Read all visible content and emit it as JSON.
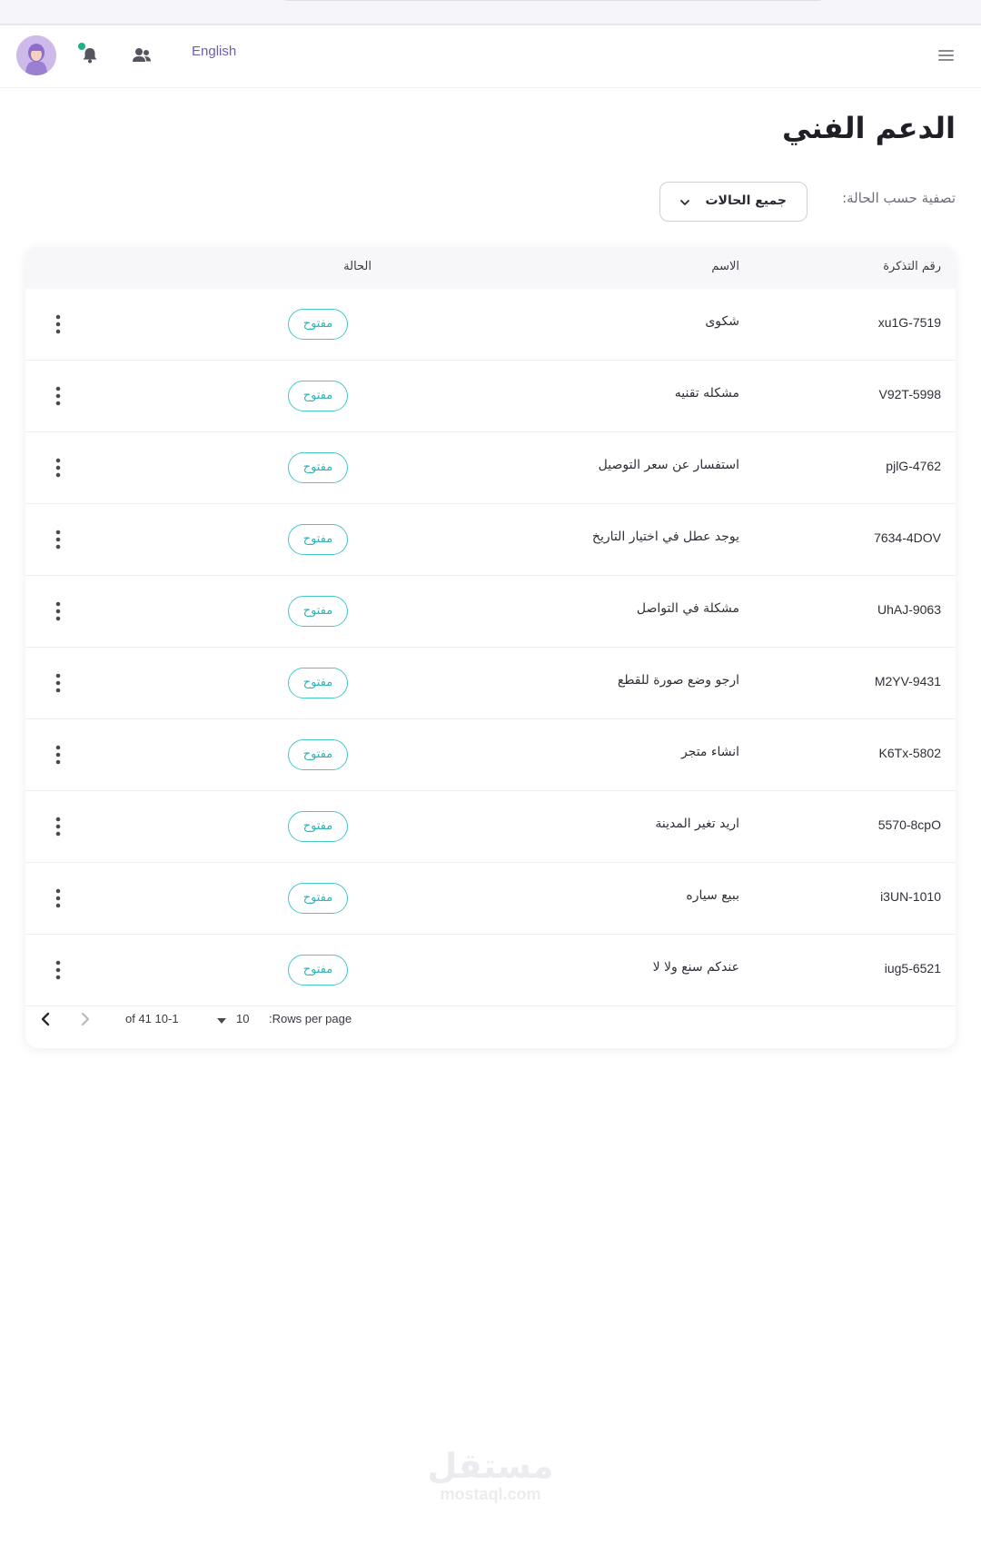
{
  "header": {
    "language_label": "English",
    "avatar": "user-avatar",
    "notification_icon": "bell-icon",
    "notification_dot_color": "#1db386",
    "users_icon": "people-icon",
    "menu_icon": "hamburger-menu-icon"
  },
  "page": {
    "title": "الدعم الفني"
  },
  "filter": {
    "label": "تصفية حسب الحالة:",
    "value": "جميع الحالات"
  },
  "table": {
    "columns": {
      "ticket": "رقم التذكرة",
      "name": "الاسم",
      "status": "الحالة"
    },
    "rows": [
      {
        "ticket": "xu1G-7519",
        "name": "شكوى",
        "status": "مفتوح"
      },
      {
        "ticket": "V92T-5998",
        "name": "مشكله تقنيه",
        "status": "مفتوح"
      },
      {
        "ticket": "pjlG-4762",
        "name": "استفسار عن سعر التوصيل",
        "status": "مفتوح"
      },
      {
        "ticket": "7634-4DOV",
        "name": "يوجد عطل في اختيار التاريخ",
        "status": "مفتوح"
      },
      {
        "ticket": "UhAJ-9063",
        "name": "مشكلة في التواصل",
        "status": "مفتوح"
      },
      {
        "ticket": "M2YV-9431",
        "name": "ارجو وضع صورة للقطع",
        "status": "مفتوح"
      },
      {
        "ticket": "K6Tx-5802",
        "name": "انشاء متجر",
        "status": "مفتوح"
      },
      {
        "ticket": "5570-8cpO",
        "name": "اريد تغير المدينة",
        "status": "مفتوح"
      },
      {
        "ticket": "i3UN-1010",
        "name": "ببيع سياره",
        "status": "مفتوح"
      },
      {
        "ticket": "iug5-6521",
        "name": "عندكم سنع ولا لا",
        "status": "مفتوح"
      }
    ]
  },
  "pagination": {
    "rows_per_page_label": ":Rows per page",
    "rows_per_page_value": "10",
    "range_text": "of 41 10-1"
  },
  "colors": {
    "accent": "#6b5fb0",
    "status_border": "#46c7c9",
    "status_text": "#2fb1b6"
  },
  "watermark": {
    "arabic": "مستقل",
    "latin": "mostaql.com"
  }
}
